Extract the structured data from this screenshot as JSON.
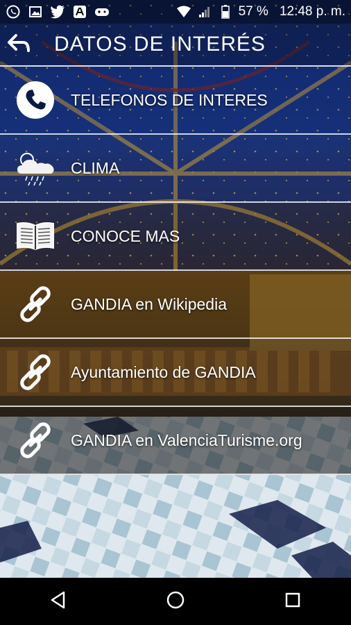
{
  "status_bar": {
    "battery": "57 %",
    "time": "12:48 p. m.",
    "icons": [
      "whatsapp-icon",
      "gallery-icon",
      "twitter-icon",
      "ad-icon",
      "game-icon",
      "wifi-icon",
      "signal-icon",
      "battery-icon"
    ]
  },
  "header": {
    "title": "DATOS DE INTERÉS",
    "back_icon": "back-arrow-icon"
  },
  "menu": {
    "items": [
      {
        "label": "TELEFONOS DE INTERES",
        "icon": "phone-icon"
      },
      {
        "label": "CLIMA",
        "icon": "weather-icon"
      },
      {
        "label": "CONOCE MAS",
        "icon": "book-icon"
      },
      {
        "label": "GANDIA en Wikipedia",
        "icon": "link-icon"
      },
      {
        "label": "Ayuntamiento de GANDIA",
        "icon": "link-icon"
      },
      {
        "label": "GANDIA en ValenciaTurisme.org",
        "icon": "link-icon"
      }
    ]
  },
  "nav_bar": {
    "buttons": [
      "back-triangle-icon",
      "home-circle-icon",
      "recents-square-icon"
    ]
  },
  "colors": {
    "accent": "#ffffff",
    "ceiling_blue": "#1e3c8c",
    "gold": "#c9a24a"
  }
}
